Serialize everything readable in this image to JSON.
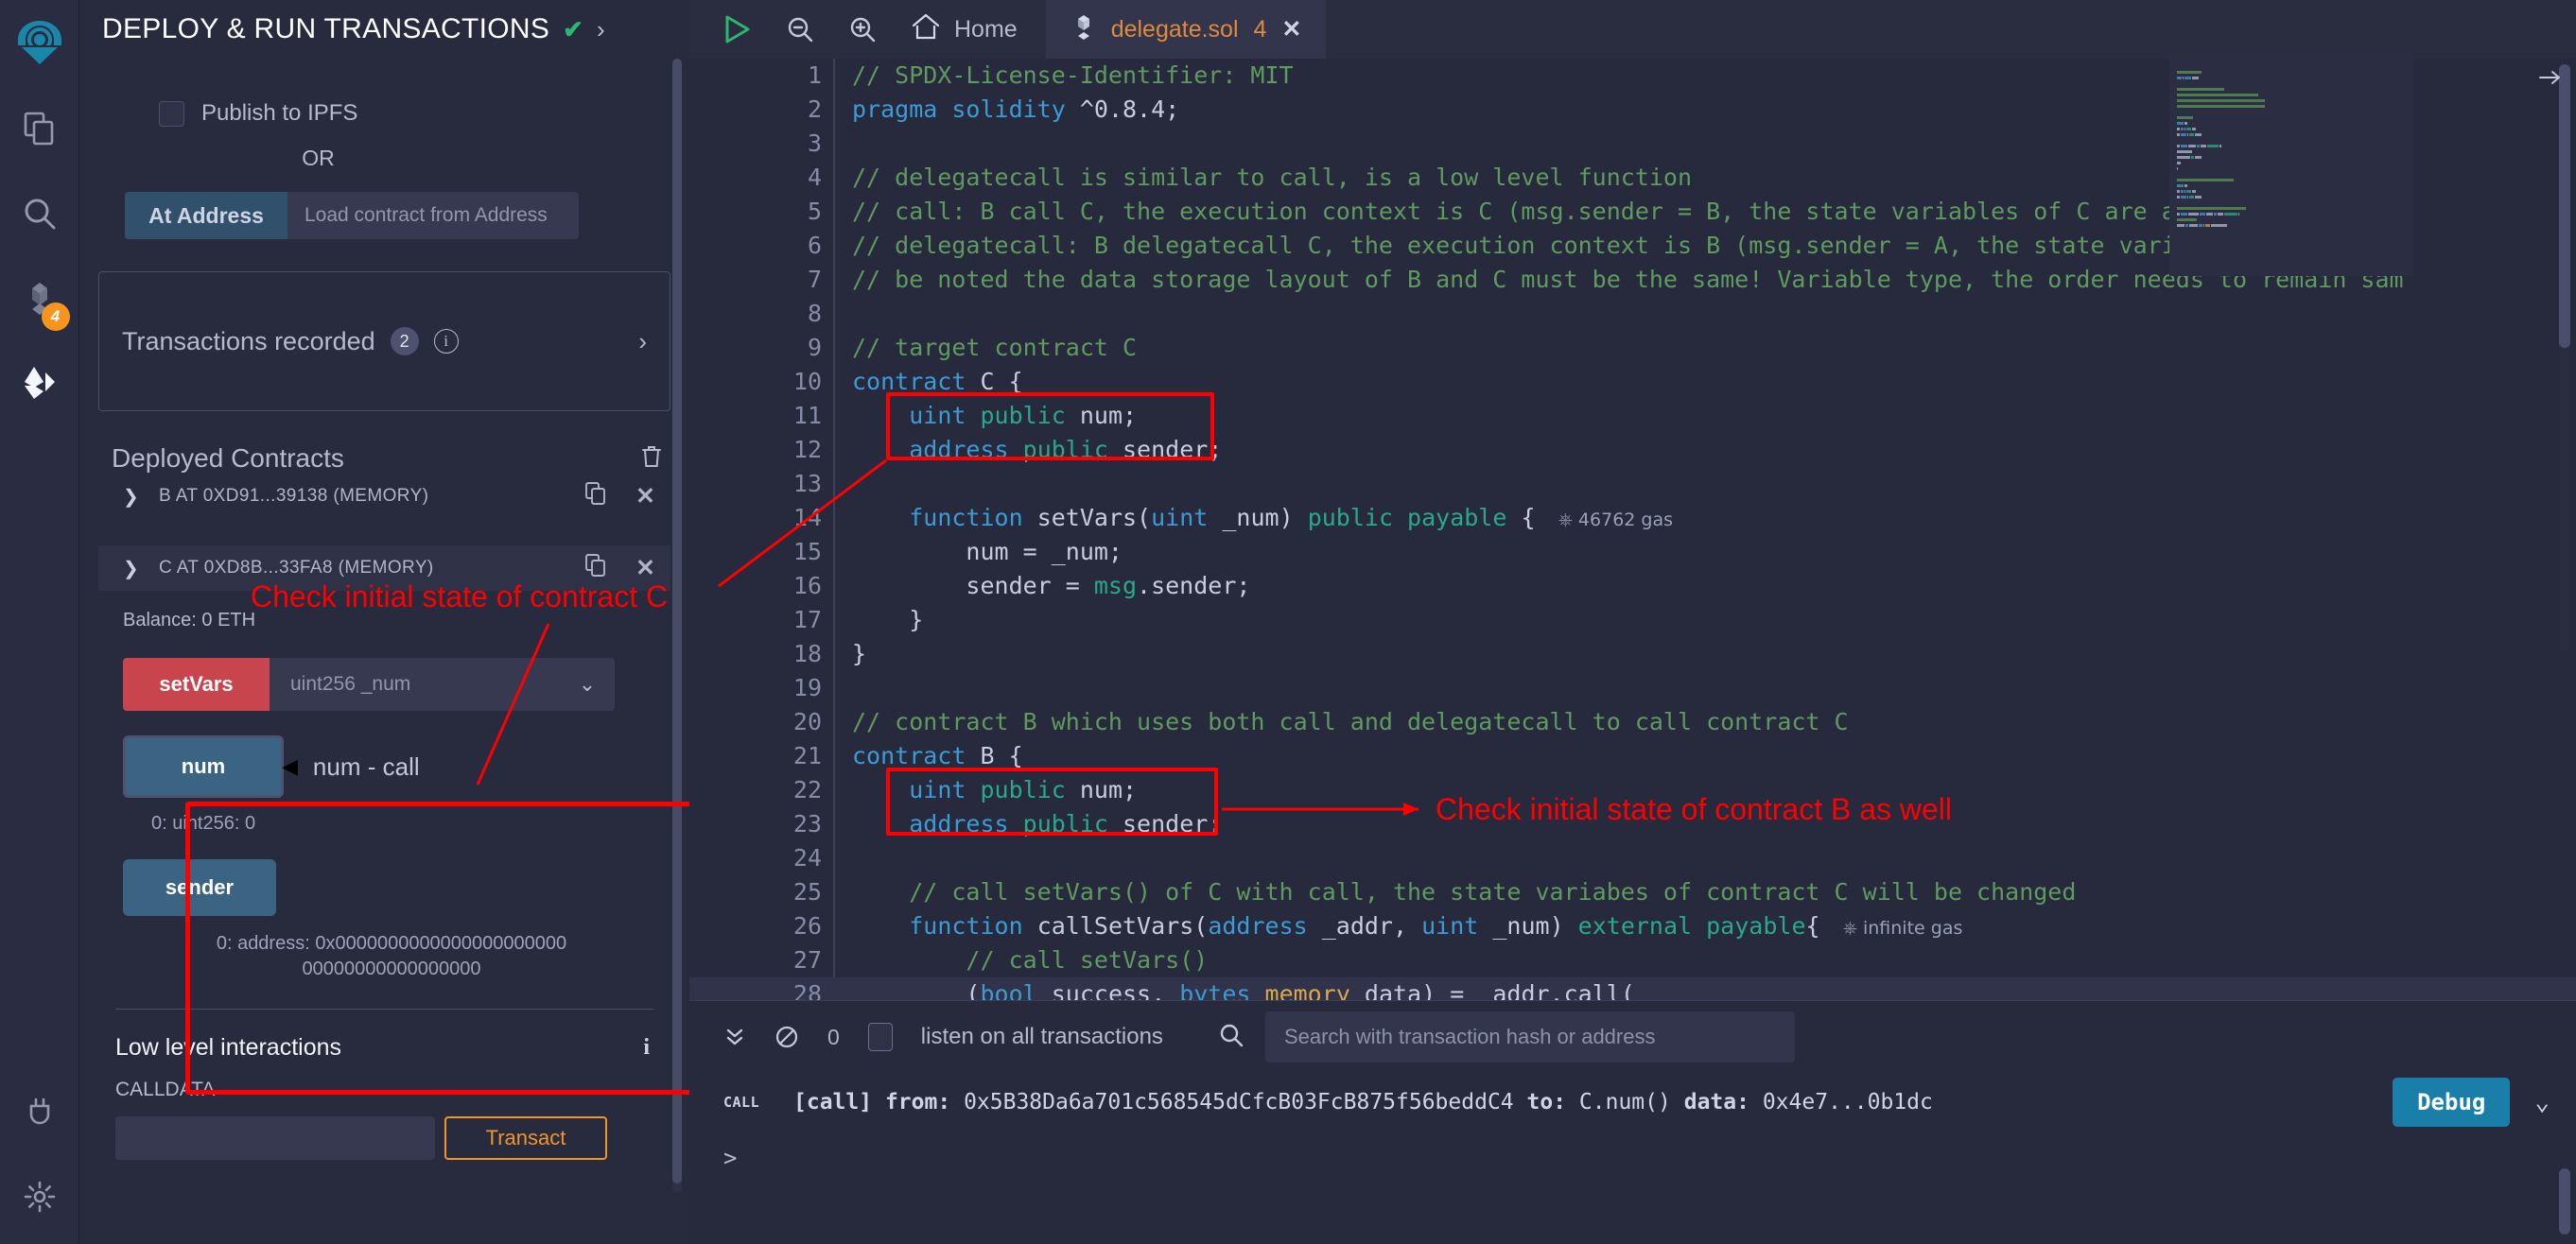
{
  "rail": {
    "logo_icon": "remix-logo-icon",
    "items": [
      {
        "icon": "file-explorer-icon",
        "name": "file-explorer"
      },
      {
        "icon": "search-icon",
        "name": "search-in-files"
      },
      {
        "icon": "solidity-compiler-icon",
        "name": "solidity-compiler",
        "badge": "4"
      },
      {
        "icon": "deploy-run-icon",
        "name": "deploy-and-run"
      }
    ],
    "bottom": [
      {
        "icon": "plugin-manager-icon",
        "name": "plugin-manager"
      },
      {
        "icon": "settings-gear-icon",
        "name": "settings"
      }
    ]
  },
  "panel": {
    "title": "DEPLOY & RUN TRANSACTIONS",
    "status_icon": "check-icon",
    "expand_icon": "chevron-right-icon",
    "publish_ipfs_label": "Publish to IPFS",
    "or_label": "OR",
    "at_address_button": "At Address",
    "at_address_placeholder": "Load contract from Address",
    "transactions_recorded_label": "Transactions recorded",
    "transactions_recorded_count": "2",
    "deployed_contracts_label": "Deployed Contracts",
    "contracts": [
      {
        "name": "B AT 0XD91...39138 (MEMORY)",
        "expanded": false
      },
      {
        "name": "C AT 0XD8B...33FA8 (MEMORY)",
        "expanded": true
      }
    ],
    "balance": "Balance: 0 ETH",
    "function_button": "setVars",
    "function_placeholder": "uint256 _num",
    "getters": [
      {
        "label": "num",
        "value": "0: uint256: 0",
        "note": "num - call"
      },
      {
        "label": "sender",
        "value": "0: address: 0x00000000000000000000000000000000000000000"
      }
    ],
    "sender_value_line1": "0: address: 0x0000000000000000000000",
    "sender_value_line2": "00000000000000000",
    "low_level_title": "Low level interactions",
    "calldata_label": "CALLDATA",
    "transact_button": "Transact"
  },
  "editor": {
    "toolbar": {
      "run_icon": "play-run-icon",
      "zoom_out_icon": "zoom-out-icon",
      "zoom_in_icon": "zoom-in-icon",
      "home_icon": "home-icon",
      "home_label": "Home"
    },
    "tab": {
      "file_icon": "solidity-file-icon",
      "name": "delegate.sol",
      "count": "4",
      "close_icon": "close-icon"
    },
    "gas_labels": {
      "setvars": "46762 gas",
      "callsetvars": "infinite gas"
    },
    "lines": [
      {
        "n": "1",
        "parts": [
          {
            "t": "// SPDX-License-Identifier: MIT",
            "c": "cm"
          }
        ]
      },
      {
        "n": "2",
        "parts": [
          {
            "t": "pragma",
            "c": "kw"
          },
          {
            "t": " ",
            "c": "id"
          },
          {
            "t": "solidity",
            "c": "kw"
          },
          {
            "t": " ^0.8.4;",
            "c": "id"
          }
        ]
      },
      {
        "n": "3",
        "parts": []
      },
      {
        "n": "4",
        "parts": [
          {
            "t": "// delegatecall is similar to call, is a low level function",
            "c": "cm"
          }
        ]
      },
      {
        "n": "5",
        "parts": [
          {
            "t": "// call: B call C, the execution context is C (msg.sender = B, the state variables of C are affected)",
            "c": "cm"
          }
        ]
      },
      {
        "n": "6",
        "parts": [
          {
            "t": "// delegatecall: B delegatecall C, the execution context is B (msg.sender = A, the state variables of B are a",
            "c": "cm"
          }
        ]
      },
      {
        "n": "7",
        "parts": [
          {
            "t": "// be noted the data storage layout of B and C must be the same! Variable type, the order needs to remain sam",
            "c": "cm"
          }
        ]
      },
      {
        "n": "8",
        "parts": []
      },
      {
        "n": "9",
        "parts": [
          {
            "t": "// target contract C",
            "c": "cm"
          }
        ]
      },
      {
        "n": "10",
        "parts": [
          {
            "t": "contract",
            "c": "kw"
          },
          {
            "t": " C {",
            "c": "id"
          }
        ]
      },
      {
        "n": "11",
        "parts": [
          {
            "t": "    ",
            "c": "id"
          },
          {
            "t": "uint",
            "c": "ty"
          },
          {
            "t": " ",
            "c": "id"
          },
          {
            "t": "public",
            "c": "kw2"
          },
          {
            "t": " num;",
            "c": "id"
          }
        ]
      },
      {
        "n": "12",
        "parts": [
          {
            "t": "    ",
            "c": "id"
          },
          {
            "t": "address",
            "c": "ty"
          },
          {
            "t": " ",
            "c": "id"
          },
          {
            "t": "public",
            "c": "kw2"
          },
          {
            "t": " sender;",
            "c": "id"
          }
        ]
      },
      {
        "n": "13",
        "parts": []
      },
      {
        "n": "14",
        "parts": [
          {
            "t": "    ",
            "c": "id"
          },
          {
            "t": "function",
            "c": "kw"
          },
          {
            "t": " setVars(",
            "c": "id"
          },
          {
            "t": "uint",
            "c": "ty"
          },
          {
            "t": " _num) ",
            "c": "id"
          },
          {
            "t": "public payable",
            "c": "kw2"
          },
          {
            "t": " {",
            "c": "id"
          }
        ],
        "gas": "46762 gas"
      },
      {
        "n": "15",
        "parts": [
          {
            "t": "        num = _num;",
            "c": "id"
          }
        ]
      },
      {
        "n": "16",
        "parts": [
          {
            "t": "        sender = ",
            "c": "id"
          },
          {
            "t": "msg",
            "c": "kw2"
          },
          {
            "t": ".sender;",
            "c": "id"
          }
        ]
      },
      {
        "n": "17",
        "parts": [
          {
            "t": "    }",
            "c": "id"
          }
        ]
      },
      {
        "n": "18",
        "parts": [
          {
            "t": "}",
            "c": "id"
          }
        ]
      },
      {
        "n": "19",
        "parts": []
      },
      {
        "n": "20",
        "parts": [
          {
            "t": "// contract B which uses both call and delegatecall to call contract C",
            "c": "cm"
          }
        ]
      },
      {
        "n": "21",
        "parts": [
          {
            "t": "contract",
            "c": "kw"
          },
          {
            "t": " B {",
            "c": "id"
          }
        ]
      },
      {
        "n": "22",
        "parts": [
          {
            "t": "    ",
            "c": "id"
          },
          {
            "t": "uint",
            "c": "ty"
          },
          {
            "t": " ",
            "c": "id"
          },
          {
            "t": "public",
            "c": "kw2"
          },
          {
            "t": " num;",
            "c": "id"
          }
        ]
      },
      {
        "n": "23",
        "parts": [
          {
            "t": "    ",
            "c": "id"
          },
          {
            "t": "address",
            "c": "ty"
          },
          {
            "t": " ",
            "c": "id"
          },
          {
            "t": "public",
            "c": "kw2"
          },
          {
            "t": " sender;",
            "c": "id"
          }
        ]
      },
      {
        "n": "24",
        "parts": []
      },
      {
        "n": "25",
        "parts": [
          {
            "t": "    // call setVars() of C with call, the state variabes of contract C will be changed",
            "c": "cm"
          }
        ]
      },
      {
        "n": "26",
        "parts": [
          {
            "t": "    ",
            "c": "id"
          },
          {
            "t": "function",
            "c": "kw"
          },
          {
            "t": " callSetVars(",
            "c": "id"
          },
          {
            "t": "address",
            "c": "ty"
          },
          {
            "t": " _addr, ",
            "c": "id"
          },
          {
            "t": "uint",
            "c": "ty"
          },
          {
            "t": " _num) ",
            "c": "id"
          },
          {
            "t": "external payable",
            "c": "kw2"
          },
          {
            "t": "{",
            "c": "id"
          }
        ],
        "gas": "infinite gas"
      },
      {
        "n": "27",
        "parts": [
          {
            "t": "        // call setVars()",
            "c": "cm"
          }
        ]
      },
      {
        "n": "28",
        "parts": [
          {
            "t": "        (",
            "c": "id"
          },
          {
            "t": "bool",
            "c": "ty"
          },
          {
            "t": " success, ",
            "c": "id"
          },
          {
            "t": "bytes",
            "c": "ty"
          },
          {
            "t": " ",
            "c": "id"
          },
          {
            "t": "memory",
            "c": "mem"
          },
          {
            "t": " data) = _addr.call(",
            "c": "id"
          }
        ],
        "hl": true
      }
    ]
  },
  "terminal": {
    "collapse_icon": "double-chevron-down-icon",
    "clear_icon": "no-entry-clear-icon",
    "pending_count": "0",
    "listen_label": "listen on all transactions",
    "search_icon": "search-icon",
    "search_placeholder": "Search with transaction hash or address",
    "log": {
      "tag": "CALL",
      "prefix": "[call]",
      "from_label": "from:",
      "from": "0x5B38Da6a701c568545dCfcB03FcB875f56beddC4",
      "to_label": "to:",
      "to": "C.num()",
      "data_label": "data:",
      "data": "0x4e7...0b1dc",
      "debug_button": "Debug",
      "caret_icon": "chevron-down-icon"
    },
    "prompt": ">"
  },
  "annotations": [
    {
      "text": "Check initial state of contract C",
      "name": "annotation-contract-c"
    },
    {
      "text": "Check initial state of contract B as well",
      "name": "annotation-contract-b"
    }
  ],
  "colors": {
    "accent_red": "#ff0000",
    "panel_bg": "#282a3e",
    "editor_bg": "#272a3d",
    "badge_orange": "#f7941e",
    "debug_blue": "#1a7fa8",
    "setvars_red": "#c9454d",
    "getter_blue": "#3a6482"
  }
}
